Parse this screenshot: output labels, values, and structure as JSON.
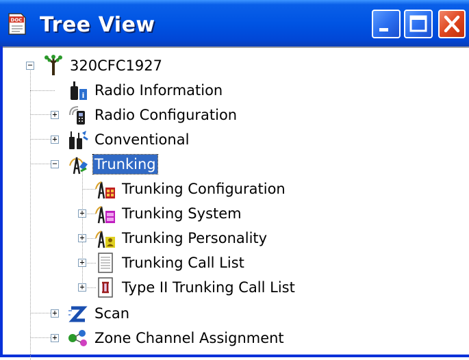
{
  "window": {
    "title": "Tree View",
    "app_icon": "doc-icon",
    "controls": [
      "minimize-icon",
      "maximize-icon",
      "close-icon"
    ]
  },
  "tree": {
    "root": {
      "label": "320CFC1927",
      "icon": "radio-tree-icon",
      "expanded": true
    },
    "items": [
      {
        "label": "Radio Information",
        "icon": "radio-info-icon",
        "expandable": false
      },
      {
        "label": "Radio Configuration",
        "icon": "radio-config-icon",
        "expandable": true,
        "expanded": false
      },
      {
        "label": "Conventional",
        "icon": "conventional-icon",
        "expandable": true,
        "expanded": false
      },
      {
        "label": "Trunking",
        "icon": "trunking-icon",
        "expandable": true,
        "expanded": true,
        "selected": true,
        "children": [
          {
            "label": "Trunking Configuration",
            "icon": "trunking-config-icon",
            "expandable": false
          },
          {
            "label": "Trunking System",
            "icon": "trunking-system-icon",
            "expandable": true
          },
          {
            "label": "Trunking Personality",
            "icon": "trunking-personality-icon",
            "expandable": true
          },
          {
            "label": "Trunking Call List",
            "icon": "call-list-icon",
            "expandable": true
          },
          {
            "label": "Type II Trunking Call List",
            "icon": "type2-call-list-icon",
            "expandable": true
          }
        ]
      },
      {
        "label": "Scan",
        "icon": "scan-icon",
        "expandable": true,
        "expanded": false
      },
      {
        "label": "Zone Channel Assignment",
        "icon": "zone-channel-icon",
        "expandable": true,
        "expanded": false
      }
    ]
  },
  "colors": {
    "titlebar": "#0054e3",
    "selection": "#316ac5",
    "close_button": "#e0471f"
  }
}
